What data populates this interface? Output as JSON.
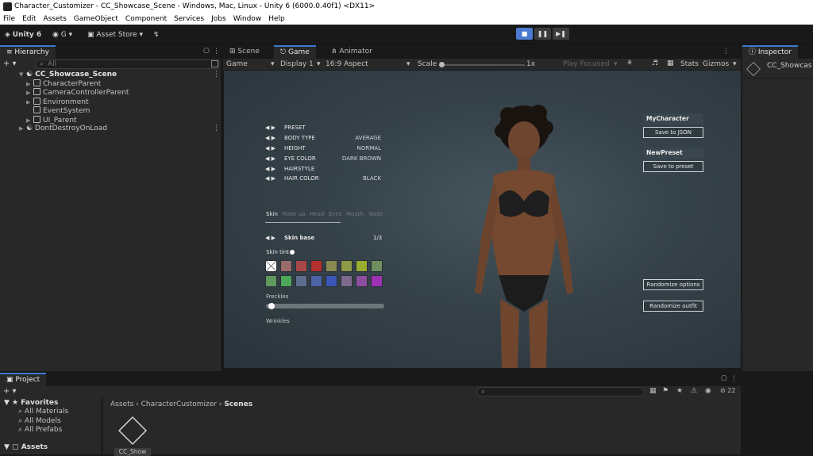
{
  "window": {
    "title": "Character_Customizer - CC_Showcase_Scene - Windows, Mac, Linux - Unity 6 (6000.0.40f1) <DX11>"
  },
  "menu": [
    "File",
    "Edit",
    "Assets",
    "GameObject",
    "Component",
    "Services",
    "Jobs",
    "Window",
    "Help"
  ],
  "toolbar": {
    "unity_label": "Unity 6",
    "account_label": "G",
    "asset_store": "Asset Store"
  },
  "hierarchy": {
    "tab": "Hierarchy",
    "search_placeholder": "All",
    "scene": "CC_Showcase_Scene",
    "items": [
      "CharacterParent",
      "CameraControllerParent",
      "Environment",
      "EventSystem",
      "UI_Parent"
    ],
    "dont_destroy": "DontDestroyOnLoad"
  },
  "viewtabs": {
    "scene": "Scene",
    "game": "Game",
    "animator": "Animator"
  },
  "gamebar": {
    "mode": "Game",
    "display": "Display 1",
    "aspect": "16:9 Aspect",
    "scale_label": "Scale",
    "scale_value": "1x",
    "play_focused": "Play Focused",
    "stats": "Stats",
    "gizmos": "Gizmos"
  },
  "inspector": {
    "tab": "Inspector",
    "object": "CC_Showcas"
  },
  "customizer": {
    "options": [
      {
        "label": "PRESET",
        "value": ""
      },
      {
        "label": "BODY TYPE",
        "value": "AVERAGE"
      },
      {
        "label": "HEIGHT",
        "value": "NORMAL"
      },
      {
        "label": "EYE COLOR",
        "value": "DARK BROWN"
      },
      {
        "label": "HAIRSTYLE",
        "value": ""
      },
      {
        "label": "HAIR COLOR",
        "value": "BLACK"
      }
    ],
    "categories": [
      "Skin",
      "Make up",
      "Head",
      "Eyes",
      "Mouth",
      "Nose"
    ],
    "skin_base_label": "Skin base",
    "skin_base_value": "1/3",
    "skin_tint_label": "Skin tint",
    "freckles_label": "Freckles",
    "freckles_value": 0.02,
    "wrinkles_label": "Wrinkles",
    "character_name": "MyCharacter",
    "save_json": "Save to JSON",
    "preset_name": "NewPreset",
    "save_preset": "Save to preset",
    "randomize_options": "Randomize options",
    "randomize_outfit": "Randomize outfit",
    "swatch_colors": [
      "#ffffff",
      "#9a6b6b",
      "#a84848",
      "#b43030",
      "#8a8a52",
      "#8e9a48",
      "#98ac30",
      "#6e8e5e",
      "#5e9a5e",
      "#4aa858",
      "#5e6e8e",
      "#4e64a8",
      "#3a56b6",
      "#7e6a8e",
      "#8e4ea0",
      "#9e32b4"
    ]
  },
  "project": {
    "tab": "Project",
    "favorites": "Favorites",
    "fav_items": [
      "All Materials",
      "All Models",
      "All Prefabs"
    ],
    "assets": "Assets",
    "breadcrumb": [
      "Assets",
      "CharacterCustomizer",
      "Scenes"
    ],
    "file_label": "CC_Show",
    "count": "22"
  }
}
